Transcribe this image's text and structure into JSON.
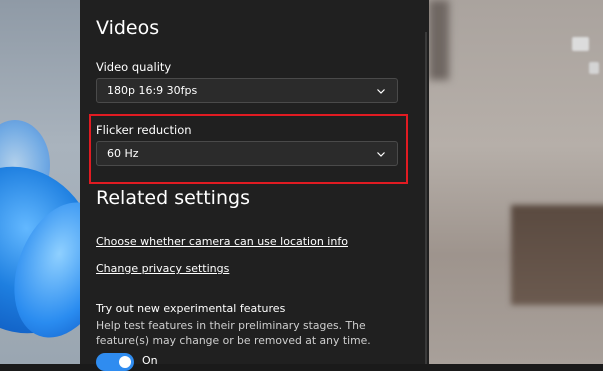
{
  "videos": {
    "title": "Videos",
    "video_quality": {
      "label": "Video quality",
      "value": "180p 16:9 30fps"
    },
    "flicker_reduction": {
      "label": "Flicker reduction",
      "value": "60 Hz"
    }
  },
  "related": {
    "title": "Related settings",
    "links": [
      "Choose whether camera can use location info",
      "Change privacy settings"
    ]
  },
  "experimental": {
    "title": "Try out new experimental features",
    "description": "Help test features in their preliminary stages. The feature(s) may change or be removed at any time.",
    "toggle_state": "On",
    "toggle_on": true
  },
  "colors": {
    "accent": "#2f8cf0",
    "highlight": "#e11b22",
    "pane": "#202020"
  }
}
